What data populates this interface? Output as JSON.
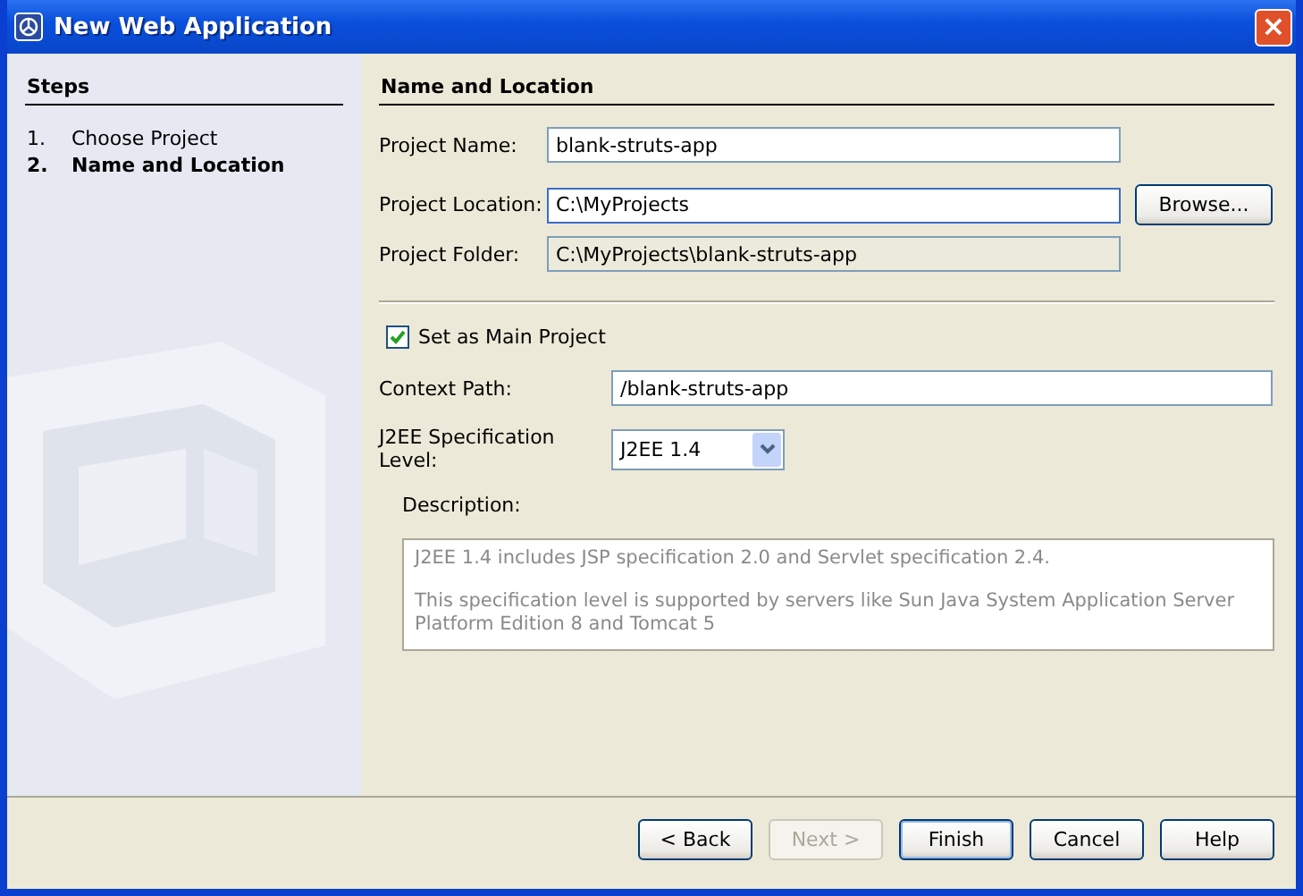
{
  "window": {
    "title": "New Web Application",
    "close": "×"
  },
  "steps": {
    "title": "Steps",
    "items": [
      {
        "number": "1.",
        "label": "Choose Project",
        "selected": false
      },
      {
        "number": "2.",
        "label": "Name and Location",
        "selected": true
      }
    ]
  },
  "panel": {
    "title": "Name and Location",
    "location_fields": [
      {
        "label": "Project Name:",
        "value": "blank-struts-app",
        "disabled": false,
        "focused": false
      },
      {
        "label": "Project Location:",
        "value": "C:\\MyProjects",
        "disabled": false,
        "focused": true,
        "button": "Browse..."
      },
      {
        "label": "Project Folder:",
        "value": "C:\\MyProjects\\blank-struts-app",
        "disabled": true,
        "focused": false
      }
    ],
    "main_project": {
      "label": "Set as Main Project",
      "checked": true
    },
    "context_path": {
      "label": "Context Path:",
      "value": "/blank-struts-app"
    },
    "spec_level": {
      "label": "J2EE Specification Level:",
      "value": "J2EE 1.4"
    },
    "description": {
      "label": "Description:",
      "paragraphs": [
        "J2EE 1.4 includes JSP specification 2.0 and Servlet specification 2.4.",
        "This specification level is supported by servers like Sun Java System Application Server Platform Edition 8 and Tomcat 5"
      ]
    }
  },
  "buttons": [
    {
      "label": "< Back",
      "disabled": false,
      "default": false
    },
    {
      "label": "Next >",
      "disabled": true,
      "default": false
    },
    {
      "label": "Finish",
      "disabled": false,
      "default": true
    },
    {
      "label": "Cancel",
      "disabled": false,
      "default": false
    },
    {
      "label": "Help",
      "disabled": false,
      "default": false
    }
  ]
}
